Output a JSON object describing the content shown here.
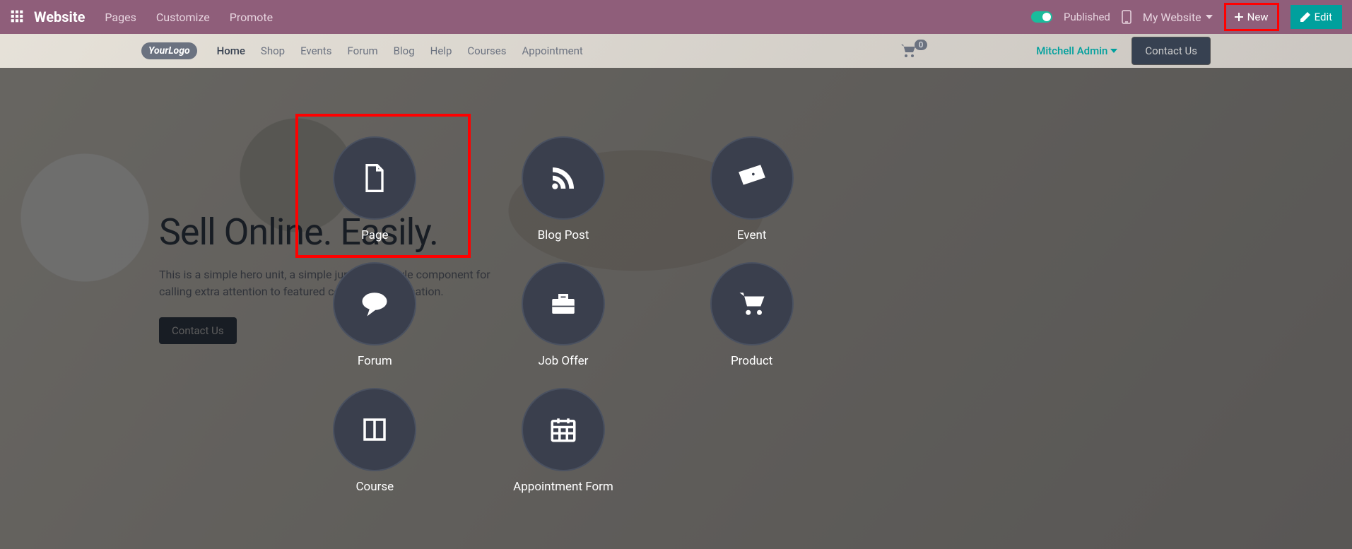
{
  "toolbar": {
    "brand": "Website",
    "menu": [
      "Pages",
      "Customize",
      "Promote"
    ],
    "published_label": "Published",
    "mywebsite_label": "My Website",
    "new_label": "New",
    "edit_label": "Edit"
  },
  "site": {
    "logo_text": "YourLogo",
    "nav": [
      "Home",
      "Shop",
      "Events",
      "Forum",
      "Blog",
      "Help",
      "Courses",
      "Appointment"
    ],
    "cart_count": "0",
    "user_name": "Mitchell Admin",
    "contact_label": "Contact Us"
  },
  "hero": {
    "title": "Sell Online. Easily.",
    "description": "This is a simple hero unit, a simple jumbotron-style component for calling extra attention to featured content or information.",
    "button": "Contact Us"
  },
  "picker": {
    "items": [
      {
        "label": "Page",
        "icon": "file"
      },
      {
        "label": "Blog Post",
        "icon": "rss"
      },
      {
        "label": "Event",
        "icon": "ticket"
      },
      {
        "label": "Forum",
        "icon": "comment"
      },
      {
        "label": "Job Offer",
        "icon": "briefcase"
      },
      {
        "label": "Product",
        "icon": "cart"
      },
      {
        "label": "Course",
        "icon": "book"
      },
      {
        "label": "Appointment Form",
        "icon": "calendar"
      }
    ]
  }
}
